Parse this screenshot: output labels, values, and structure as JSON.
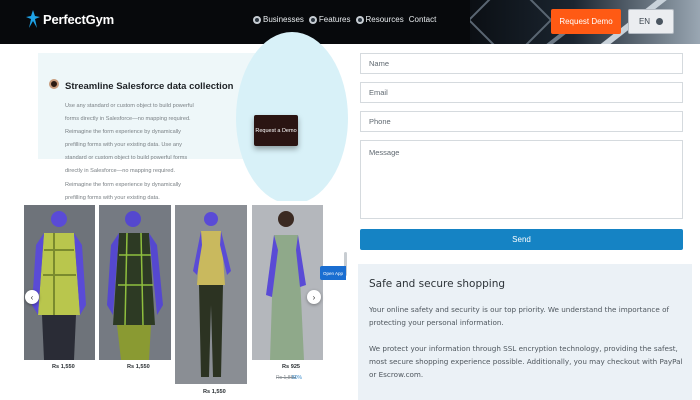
{
  "header": {
    "logo_text": "PerfectGym",
    "nav": [
      {
        "label": "Businesses",
        "icon": "globe-icon"
      },
      {
        "label": "Features",
        "icon": "globe-icon"
      },
      {
        "label": "Resources",
        "icon": "globe-icon"
      },
      {
        "label": "Contact",
        "icon": ""
      }
    ],
    "request_demo_label": "Request Demo",
    "language_label": "EN",
    "accent_color": "#ff5a14"
  },
  "salesforce": {
    "title": "Streamline Salesforce data collection",
    "body": "Use any standard or custom object to build powerful forms directly in Salesforce—no mapping required. Reimagine the form experience by dynamically prefilling forms with your existing data. Use any standard or custom object to build powerful forms directly in Salesforce—no mapping required. Reimagine the form experience by dynamically prefilling forms with your existing data.",
    "button_label": "Request a Demo"
  },
  "form": {
    "name_placeholder": "Name",
    "email_placeholder": "Email",
    "phone_placeholder": "Phone",
    "message_placeholder": "Message",
    "send_label": "Send",
    "send_color": "#1583c4"
  },
  "products": {
    "items": [
      {
        "price": "Rs 1,550"
      },
      {
        "price": "Rs 1,550"
      },
      {
        "price": "Rs 1,550"
      },
      {
        "price": "Rs 925",
        "old_price": "Rs 1,850",
        "discount": "50%"
      }
    ],
    "prev_icon": "chevron-left-icon",
    "next_icon": "chevron-right-icon",
    "open_app_label": "Open App"
  },
  "secure": {
    "title": "Safe and secure shopping",
    "paragraph1": "Your online safety and security is our top priority. We understand the importance of protecting your personal information.",
    "paragraph2": "We protect your information through SSL encryption technology, providing the safest, most secure shopping experience possible. Additionally, you may checkout with PayPal or Escrow.com."
  }
}
